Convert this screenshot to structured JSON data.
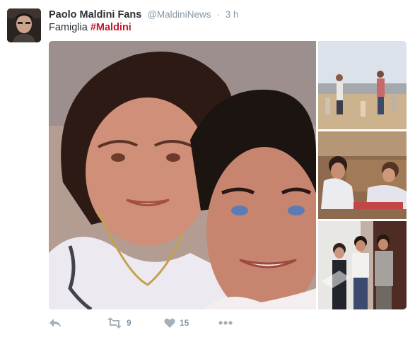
{
  "tweet": {
    "display_name": "Paolo Maldini Fans",
    "handle": "@MaldiniNews",
    "separator": "·",
    "time": "3 h",
    "text_plain": "Famiglia ",
    "hashtag": "#Maldini",
    "media_count": 4
  },
  "actions": {
    "retweet_count": "9",
    "like_count": "15"
  },
  "colors": {
    "hashtag": "#c0172b",
    "meta_gray": "#8899a6",
    "text": "#292f33"
  }
}
